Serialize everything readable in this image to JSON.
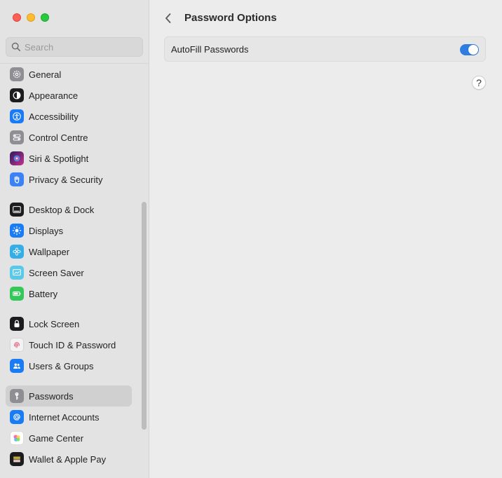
{
  "window": {
    "traffic_lights": [
      "close",
      "minimize",
      "zoom"
    ]
  },
  "search": {
    "placeholder": "Search",
    "value": ""
  },
  "sidebar": {
    "items": [
      {
        "label": "General",
        "icon": "gear-icon",
        "color": "#8e8e93",
        "selected": false
      },
      {
        "label": "Appearance",
        "icon": "appearance-icon",
        "color": "#1c1c1e",
        "selected": false
      },
      {
        "label": "Accessibility",
        "icon": "accessibility-icon",
        "color": "#1a7cf5",
        "selected": false
      },
      {
        "label": "Control Centre",
        "icon": "control-centre-icon",
        "color": "#8e8e93",
        "selected": false
      },
      {
        "label": "Siri & Spotlight",
        "icon": "siri-icon",
        "color": "#6b2fbf",
        "selected": false
      },
      {
        "label": "Privacy & Security",
        "icon": "hand-icon",
        "color": "#3a82f6",
        "selected": false
      },
      {
        "label": "Desktop & Dock",
        "icon": "dock-icon",
        "color": "#1c1c1e",
        "selected": false
      },
      {
        "label": "Displays",
        "icon": "sun-icon",
        "color": "#1a7cf5",
        "selected": false
      },
      {
        "label": "Wallpaper",
        "icon": "flower-icon",
        "color": "#35aee8",
        "selected": false
      },
      {
        "label": "Screen Saver",
        "icon": "screensaver-icon",
        "color": "#5ac8e8",
        "selected": false
      },
      {
        "label": "Battery",
        "icon": "battery-icon",
        "color": "#34c759",
        "selected": false
      },
      {
        "label": "Lock Screen",
        "icon": "lock-icon",
        "color": "#1c1c1e",
        "selected": false
      },
      {
        "label": "Touch ID & Password",
        "icon": "fingerprint-icon",
        "color": "#f2f2f2",
        "selected": false
      },
      {
        "label": "Users & Groups",
        "icon": "users-icon",
        "color": "#1a7cf5",
        "selected": false
      },
      {
        "label": "Passwords",
        "icon": "key-icon",
        "color": "#8e8e93",
        "selected": true
      },
      {
        "label": "Internet Accounts",
        "icon": "at-icon",
        "color": "#1a7cf5",
        "selected": false
      },
      {
        "label": "Game Center",
        "icon": "game-center-icon",
        "color": "#ffffff",
        "selected": false
      },
      {
        "label": "Wallet & Apple Pay",
        "icon": "wallet-icon",
        "color": "#1c1c1e",
        "selected": false
      }
    ]
  },
  "main": {
    "title": "Password Options",
    "autofill": {
      "label": "AutoFill Passwords",
      "enabled": true
    },
    "help_label": "?"
  },
  "colors": {
    "accent": "#2f7de1",
    "sidebar_bg": "#e4e3e3",
    "main_bg": "#ececec"
  }
}
